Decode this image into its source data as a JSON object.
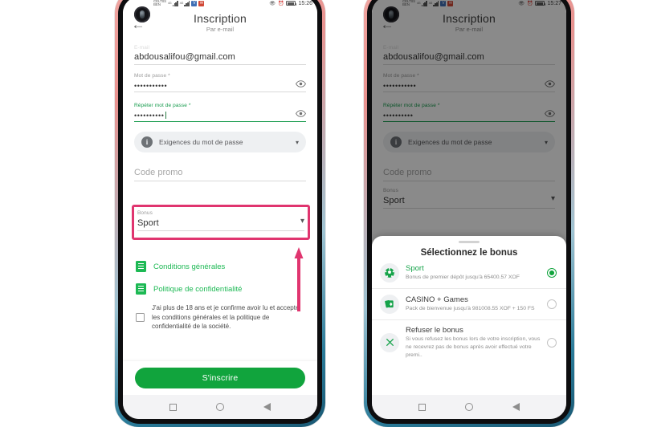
{
  "theme": {
    "accent_green": "#11a43d",
    "link_green": "#1db954",
    "highlight_pink": "#e0356f",
    "text_dark": "#333333",
    "muted": "#9a9a9a"
  },
  "phones": [
    {
      "id": "left",
      "status_bar": {
        "carrier_line1": "CELTIIS",
        "carrier_line2": "BEN",
        "network_1": "4G",
        "network_2": "4G",
        "app_icon_1": "V",
        "app_icon_2": "M",
        "battery_icon": "battery-icon",
        "alarm_icon": "alarm-icon",
        "eye_icon": "eye-icon",
        "time": "15:26"
      },
      "header": {
        "back_icon": "back-arrow-icon",
        "title": "Inscription",
        "subtitle": "Par e-mail"
      },
      "form": {
        "email": {
          "label": "E-mail",
          "value": "abdousalifou@gmail.com"
        },
        "password": {
          "label": "Mot de passe *",
          "value": "•••••••••••",
          "toggle_icon": "eye-icon"
        },
        "repeat_password": {
          "label": "Répéter mot de passe *",
          "value": "••••••••••",
          "toggle_icon": "eye-icon"
        },
        "password_requirements": {
          "label": "Exigences du mot de passe",
          "info_icon": "info-icon",
          "chevron_icon": "chevron-down-icon"
        },
        "promo": {
          "placeholder": "Code promo",
          "value": ""
        },
        "bonus": {
          "label": "Bonus",
          "value": "Sport",
          "chevron_icon": "chevron-down-icon"
        }
      },
      "links": [
        {
          "label": "Conditions générales",
          "icon": "document-icon"
        },
        {
          "label": "Politique de confidentialité",
          "icon": "document-icon"
        }
      ],
      "consent": {
        "checked": false,
        "text": "J'ai plus de 18 ans et je confirme avoir lu et accepté les conditions générales et la politique de confidentialité de la société."
      },
      "submit_label": "S'inscrire",
      "nav": {
        "recents_icon": "square-icon",
        "home_icon": "circle-icon",
        "back_icon": "triangle-back-icon"
      }
    },
    {
      "id": "right",
      "status_bar": {
        "carrier_line1": "CELTIIS",
        "carrier_line2": "BEN",
        "network_1": "4G",
        "network_2": "4G",
        "app_icon_1": "V",
        "app_icon_2": "M",
        "battery_icon": "battery-icon",
        "alarm_icon": "alarm-icon",
        "eye_icon": "eye-icon",
        "time": "15:27"
      },
      "header": {
        "back_icon": "back-arrow-icon",
        "title": "Inscription",
        "subtitle": "Par e-mail"
      },
      "form": {
        "email": {
          "label": "E-mail",
          "value": "abdousalifou@gmail.com"
        },
        "password": {
          "label": "Mot de passe *",
          "value": "•••••••••••",
          "toggle_icon": "eye-icon"
        },
        "repeat_password": {
          "label": "Répéter mot de passe *",
          "value": "••••••••••",
          "toggle_icon": "eye-icon"
        },
        "password_requirements": {
          "label": "Exigences du mot de passe",
          "info_icon": "info-icon",
          "chevron_icon": "chevron-down-icon"
        },
        "promo": {
          "placeholder": "Code promo",
          "value": ""
        },
        "bonus": {
          "label": "Bonus",
          "value": "Sport",
          "chevron_icon": "chevron-down-icon"
        }
      },
      "bottom_sheet": {
        "title": "Sélectionnez le bonus",
        "options": [
          {
            "name": "Sport",
            "description": "Bonus de premier dépôt jusqu'à 65400.57 XOF",
            "icon": "soccer-ball-icon",
            "selected": true
          },
          {
            "name": "CASINO + Games",
            "description": "Pack de bienvenue jusqu'à 981008.55 XOF + 150 FS",
            "icon": "playing-cards-icon",
            "selected": false
          },
          {
            "name": "Refuser le bonus",
            "description": "Si vous refusez les bonus lors de votre inscription, vous ne recevrez pas de bonus après avoir effectué votre premi..",
            "icon": "close-x-icon",
            "selected": false
          }
        ]
      },
      "nav": {
        "recents_icon": "square-icon",
        "home_icon": "circle-icon",
        "back_icon": "triangle-back-icon"
      }
    }
  ],
  "annotations": {
    "highlight_box_target": "bonus-field",
    "arrow": {
      "icon": "up-arrow-annotation",
      "color": "#e0356f"
    }
  }
}
